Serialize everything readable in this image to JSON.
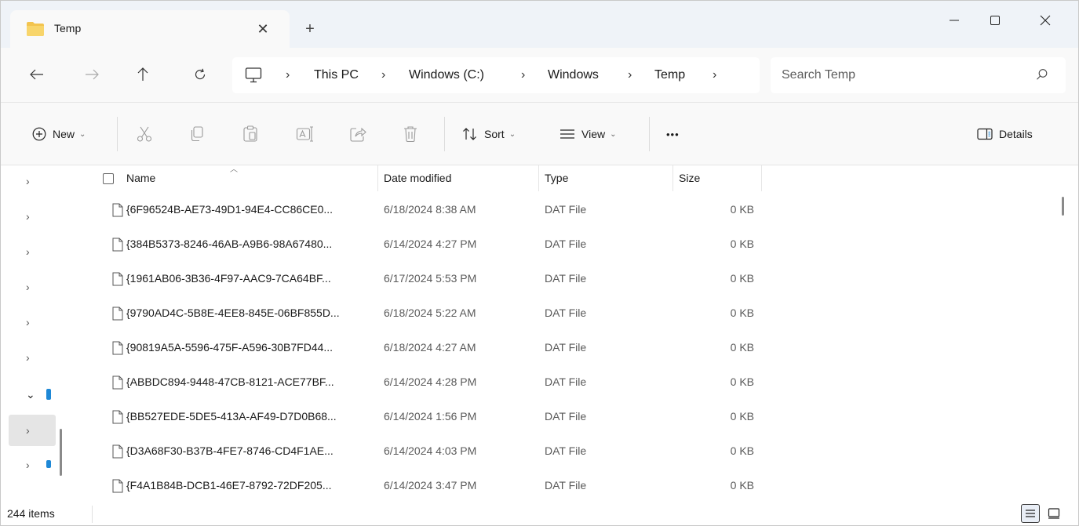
{
  "tab": {
    "title": "Temp",
    "close_glyph": "✕"
  },
  "new_tab_glyph": "+",
  "window_controls": {
    "minimize": "—",
    "maximize": "☐",
    "close": "✕"
  },
  "nav": {
    "back": "←",
    "forward": "→",
    "up": "↑",
    "refresh": "↻"
  },
  "breadcrumb": {
    "separator": "›",
    "items": [
      "This PC",
      "Windows (C:)",
      "Windows",
      "Temp"
    ]
  },
  "search": {
    "placeholder": "Search Temp"
  },
  "commands": {
    "new": "New",
    "sort": "Sort",
    "view": "View",
    "more": "•••",
    "details": "Details"
  },
  "columns": {
    "name": "Name",
    "date_modified": "Date modified",
    "type": "Type",
    "size": "Size"
  },
  "files": [
    {
      "name": "{6F96524B-AE73-49D1-94E4-CC86CE0...",
      "date": "6/18/2024 8:38 AM",
      "type": "DAT File",
      "size": "0 KB"
    },
    {
      "name": "{384B5373-8246-46AB-A9B6-98A67480...",
      "date": "6/14/2024 4:27 PM",
      "type": "DAT File",
      "size": "0 KB"
    },
    {
      "name": "{1961AB06-3B36-4F97-AAC9-7CA64BF...",
      "date": "6/17/2024 5:53 PM",
      "type": "DAT File",
      "size": "0 KB"
    },
    {
      "name": "{9790AD4C-5B8E-4EE8-845E-06BF855D...",
      "date": "6/18/2024 5:22 AM",
      "type": "DAT File",
      "size": "0 KB"
    },
    {
      "name": "{90819A5A-5596-475F-A596-30B7FD44...",
      "date": "6/18/2024 4:27 AM",
      "type": "DAT File",
      "size": "0 KB"
    },
    {
      "name": "{ABBDC894-9448-47CB-8121-ACE77BF...",
      "date": "6/14/2024 4:28 PM",
      "type": "DAT File",
      "size": "0 KB"
    },
    {
      "name": "{BB527EDE-5DE5-413A-AF49-D7D0B68...",
      "date": "6/14/2024 1:56 PM",
      "type": "DAT File",
      "size": "0 KB"
    },
    {
      "name": "{D3A68F30-B37B-4FE7-8746-CD4F1AE...",
      "date": "6/14/2024 4:03 PM",
      "type": "DAT File",
      "size": "0 KB"
    },
    {
      "name": "{F4A1B84B-DCB1-46E7-8792-72DF205...",
      "date": "6/14/2024 3:47 PM",
      "type": "DAT File",
      "size": "0 KB"
    }
  ],
  "navpane_glyphs": {
    "collapsed": "›",
    "expanded": "⌄"
  },
  "status": {
    "item_count": "244 items"
  },
  "colors": {
    "accent": "#1e88d6",
    "folder": "#f3c44f",
    "tabbar": "#eff3f8",
    "toolbar": "#f9f9f9"
  }
}
